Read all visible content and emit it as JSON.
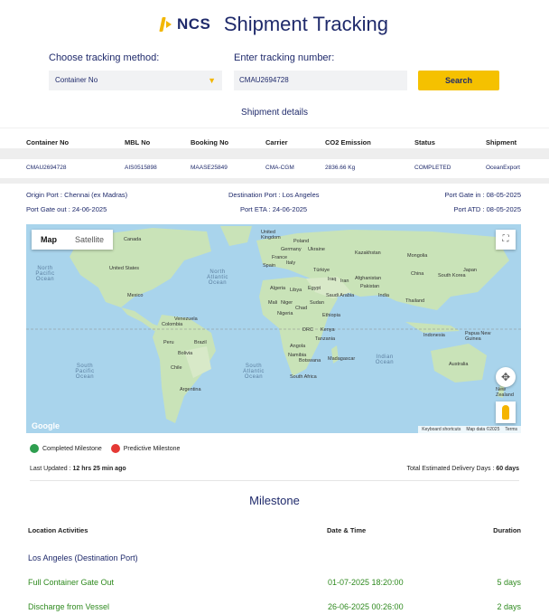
{
  "header": {
    "logo_text": "NCS",
    "title": "Shipment Tracking"
  },
  "form": {
    "method_label": "Choose tracking method:",
    "method_value": "Container No",
    "number_label": "Enter tracking number:",
    "number_value": "CMAU2694728",
    "search_label": "Search"
  },
  "details_title": "Shipment details",
  "table": {
    "headers": [
      "Container No",
      "MBL No",
      "Booking No",
      "Carrier",
      "CO2 Emission",
      "Status",
      "Shipment"
    ],
    "row": [
      "CMAU2694728",
      "AIS0515898",
      "MAASE25849",
      "CMA-CGM",
      "2836.66 Kg",
      "COMPLETED",
      "OceanExport"
    ]
  },
  "info": {
    "origin_label": "Origin Port :",
    "origin_value": "Chennai (ex Madras)",
    "dest_label": "Destination Port :",
    "dest_value": "Los Angeles",
    "gatein_label": "Port Gate in :",
    "gatein_value": "08-05-2025",
    "gateout_label": "Port Gate out :",
    "gateout_value": "24-06-2025",
    "eta_label": "Port ETA :",
    "eta_value": "24-06-2025",
    "atd_label": "Port ATD :",
    "atd_value": "08-05-2025"
  },
  "map": {
    "tab_map": "Map",
    "tab_satellite": "Satellite",
    "google": "Google",
    "footer": [
      "Keyboard shortcuts",
      "Map data ©2025",
      "Terms"
    ],
    "oceans": [
      "North Pacific Ocean",
      "North Atlantic Ocean",
      "South Pacific Ocean",
      "South Atlantic Ocean",
      "Indian Ocean"
    ],
    "labels": [
      "Canada",
      "United States",
      "Mexico",
      "Venezuela",
      "Colombia",
      "Brazil",
      "Peru",
      "Bolivia",
      "Chile",
      "Argentina",
      "United Kingdom",
      "Poland",
      "Germany",
      "Ukraine",
      "France",
      "Italy",
      "Spain",
      "Kazakhstan",
      "Mongolia",
      "Türkiye",
      "Iran",
      "Afghanistan",
      "Pakistan",
      "China",
      "South Korea",
      "Japan",
      "Iraq",
      "Egypt",
      "Saudi Arabia",
      "Algeria",
      "Libya",
      "India",
      "Thailand",
      "Mali",
      "Niger",
      "Chad",
      "Sudan",
      "Nigeria",
      "Ethiopia",
      "DRC",
      "Kenya",
      "Tanzania",
      "Angola",
      "Namibia",
      "Botswana",
      "Madagascar",
      "South Africa",
      "Indonesia",
      "Papua New Guinea",
      "Australia",
      "New Zealand"
    ]
  },
  "legend": {
    "completed": "Completed Milestone",
    "predictive": "Predictive Milestone"
  },
  "updated": {
    "label": "Last Updated :",
    "value": "12 hrs 25 min ago"
  },
  "total": {
    "label": "Total Estimated Delivery Days :",
    "value": "60 days"
  },
  "milestone": {
    "title": "Milestone",
    "headers": [
      "Location Activities",
      "Date & Time",
      "Duration"
    ],
    "location": "Los Angeles (Destination Port)",
    "rows": [
      {
        "activity": "Full Container Gate Out",
        "datetime": "01-07-2025 18:20:00",
        "duration": "5 days"
      },
      {
        "activity": "Discharge from Vessel",
        "datetime": "26-06-2025 00:26:00",
        "duration": "2 days"
      }
    ]
  },
  "colors": {
    "brand": "#1f2a6b",
    "accent": "#f5c100",
    "completed": "#2e9e4f",
    "predictive": "#e53935",
    "milestone_text": "#2f8a1f"
  }
}
